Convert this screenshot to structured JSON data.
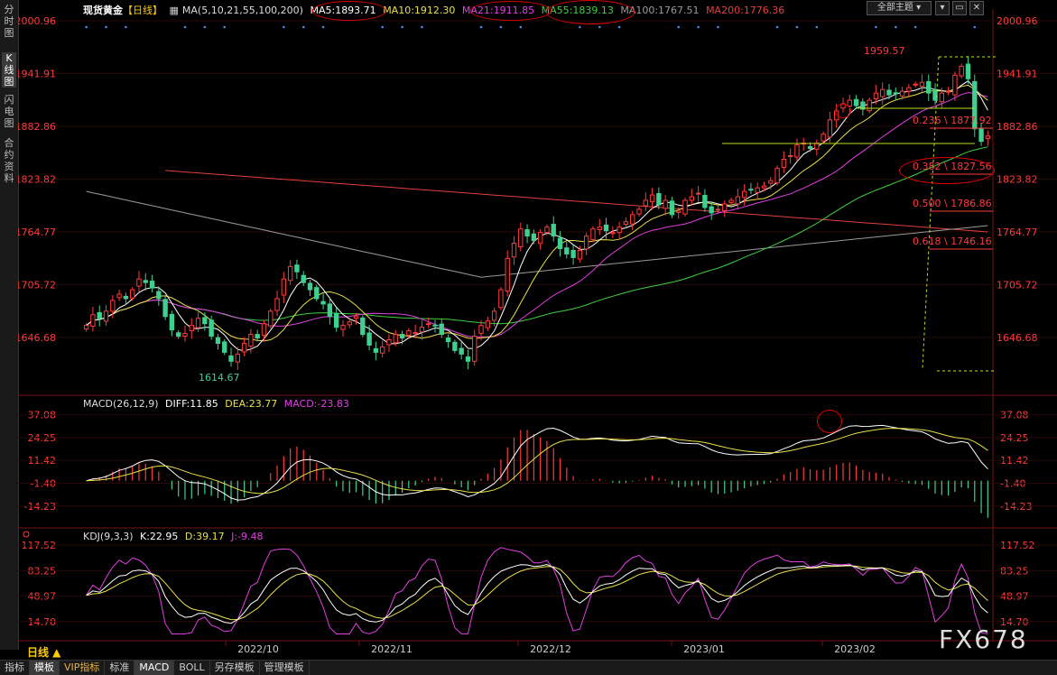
{
  "left_tabs": [
    "分时图",
    "K线图",
    "闪电图",
    "合约资料"
  ],
  "header": {
    "title": "现货黄金",
    "period_tag": "【日线】",
    "ma_params": "MA(5,10,21,55,100,200)",
    "ma_items": [
      {
        "label": "MA5:1893.71",
        "color": "#ffffff"
      },
      {
        "label": "MA10:1912.30",
        "color": "#e8e04a"
      },
      {
        "label": "MA21:1911.85",
        "color": "#e040e0"
      },
      {
        "label": "MA55:1839.13",
        "color": "#3fd03f"
      },
      {
        "label": "MA100:1767.51",
        "color": "#9a9a9a"
      },
      {
        "label": "MA200:1776.36",
        "color": "#e04040"
      }
    ],
    "theme_button": "全部主题"
  },
  "macd_legend": {
    "params": "MACD(26,12,9)",
    "diff": "DIFF:11.85",
    "dea": "DEA:23.77",
    "macd": "MACD:-23.83"
  },
  "kdj_legend": {
    "params": "KDJ(9,3,3)",
    "k": "K:22.95",
    "d": "D:39.17",
    "j": "J:-9.48"
  },
  "period_label": "日线 ▲",
  "watermark": "FX678",
  "bottom_bar": [
    "指标",
    "模板",
    "VIP指标",
    "标准",
    "MACD",
    "BOLL",
    "另存模板",
    "管理模板"
  ],
  "chart_data": {
    "type": "candlestick",
    "title": "现货黄金 日线",
    "price_axis_ticks": [
      2000.96,
      1941.91,
      1882.86,
      1823.82,
      1764.77,
      1705.72,
      1646.68
    ],
    "price_range": [
      1590,
      2010
    ],
    "macd_axis_ticks": [
      37.08,
      24.25,
      11.42,
      -1.4,
      -14.23
    ],
    "kdj_axis_ticks": [
      117.52,
      83.25,
      48.97,
      14.7
    ],
    "x_axis_labels": [
      "2022/10",
      "2022/11",
      "2022/12",
      "2023/01",
      "2023/02"
    ],
    "annotations": [
      {
        "text": "1959.57",
        "type": "high",
        "color": "#ff3a3a"
      },
      {
        "text": "1614.67",
        "type": "low",
        "color": "#3fd08f"
      }
    ],
    "fibonacci": [
      {
        "ratio": "0.236",
        "price": "1877.92",
        "label": "0.236 \\ 1877.92"
      },
      {
        "ratio": "0.382",
        "price": "1827.56",
        "label": "0.382 \\ 1827.56"
      },
      {
        "ratio": "0.500",
        "price": "1786.86",
        "label": "0.500 \\ 1786.86"
      },
      {
        "ratio": "0.618",
        "price": "1746.16",
        "label": "0.618 \\ 1746.16"
      }
    ],
    "closes": [
      1660,
      1672,
      1668,
      1676,
      1688,
      1695,
      1690,
      1700,
      1712,
      1708,
      1702,
      1690,
      1670,
      1655,
      1648,
      1651,
      1660,
      1668,
      1662,
      1648,
      1640,
      1630,
      1620,
      1628,
      1640,
      1650,
      1646,
      1662,
      1676,
      1690,
      1712,
      1726,
      1720,
      1708,
      1700,
      1690,
      1684,
      1670,
      1658,
      1660,
      1664,
      1670,
      1650,
      1638,
      1630,
      1636,
      1644,
      1650,
      1646,
      1654,
      1652,
      1658,
      1662,
      1660,
      1650,
      1642,
      1632,
      1628,
      1620,
      1648,
      1660,
      1665,
      1676,
      1700,
      1735,
      1752,
      1768,
      1760,
      1755,
      1764,
      1770,
      1760,
      1746,
      1740,
      1736,
      1744,
      1760,
      1768,
      1770,
      1766,
      1764,
      1770,
      1776,
      1784,
      1790,
      1800,
      1806,
      1795,
      1800,
      1784,
      1788,
      1800,
      1804,
      1808,
      1792,
      1786,
      1790,
      1796,
      1800,
      1804,
      1810,
      1812,
      1814,
      1816,
      1822,
      1836,
      1846,
      1850,
      1862,
      1864,
      1858,
      1864,
      1874,
      1890,
      1900,
      1908,
      1912,
      1906,
      1902,
      1912,
      1920,
      1924,
      1918,
      1920,
      1922,
      1926,
      1930,
      1932,
      1920,
      1912,
      1920,
      1922,
      1940,
      1950,
      1936,
      1880,
      1866,
      1872
    ],
    "ma5": {
      "name": "MA5",
      "value": "1893.71"
    },
    "ma10": {
      "name": "MA10",
      "value": "1912.30"
    },
    "ma21": {
      "name": "MA21",
      "value": "1911.85"
    },
    "ma55": {
      "name": "MA55",
      "value": "1839.13"
    },
    "ma100": {
      "name": "MA100",
      "value": "1767.51"
    },
    "ma200": {
      "name": "MA200",
      "value": "1776.36"
    },
    "colors": {
      "up": "#ff3a3a",
      "down": "#3fd08f",
      "ma5": "#ffffff",
      "ma10": "#e8e04a",
      "ma21": "#e040e0",
      "ma55": "#3fd03f",
      "ma100": "#9a9a9a",
      "ma200": "#e04040",
      "axis": "#ff3a3a",
      "grid": "#5a1010"
    }
  }
}
